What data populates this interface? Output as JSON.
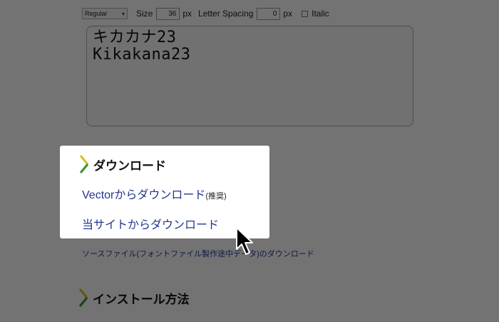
{
  "toolbar": {
    "weight_value": "Regular",
    "size_label": "Size",
    "size_value": "36",
    "size_unit": "px",
    "spacing_label": "Letter Spacing",
    "spacing_value": "0",
    "spacing_unit": "px",
    "italic_label": "Italic"
  },
  "preview": {
    "line1": "キカカナ23",
    "line2": "Kikakana23"
  },
  "popup": {
    "heading": "ダウンロード",
    "vector_link": "Vectorからダウンロード",
    "vector_note": "(推奨)",
    "site_link": "当サイトからダウンロード"
  },
  "source_link": "ソースファイル(フォントファイル製作途中データ)のダウンロード",
  "install_heading": "インストール方法",
  "colors": {
    "link": "#23368f",
    "chevron_green": "#3a8f2c",
    "chevron_yellow": "#d8c21a"
  }
}
